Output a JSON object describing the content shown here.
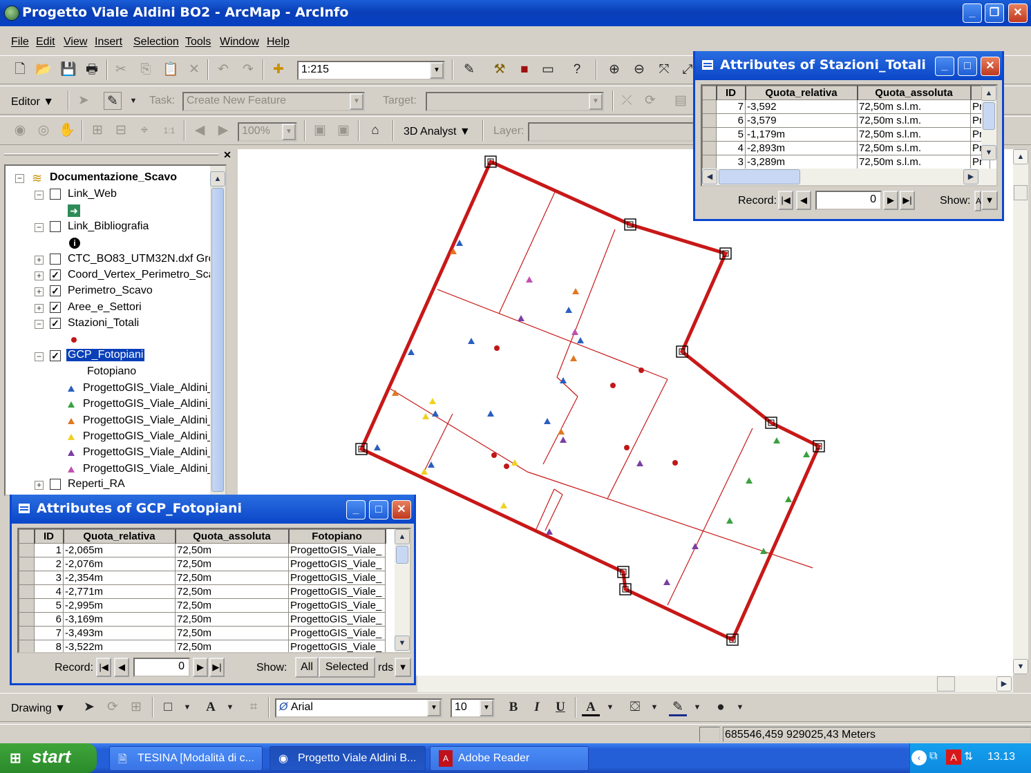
{
  "window": {
    "title": "Progetto Viale Aldini BO2 - ArcMap - ArcInfo",
    "minimize": "_",
    "maximize": "❐",
    "close": "✕"
  },
  "menu": [
    "File",
    "Edit",
    "View",
    "Insert",
    "Selection",
    "Tools",
    "Window",
    "Help"
  ],
  "standard_toolbar": {
    "scale": "1:215"
  },
  "editor_toolbar": {
    "editor_label": "Editor",
    "task_label": "Task:",
    "task_value": "Create New Feature",
    "target_label": "Target:"
  },
  "tools_toolbar": {
    "zoom_value": "100%",
    "analyst_label": "3D Analyst",
    "layer_label": "Layer:"
  },
  "toc": {
    "root": "Documentazione_Scavo",
    "items": [
      {
        "label": "Link_Web"
      },
      {
        "label": "Link_Bibliografia"
      },
      {
        "label": "CTC_BO83_UTM32N.dxf Grou"
      },
      {
        "label": "Coord_Vertex_Perimetro_Sca"
      },
      {
        "label": "Perimetro_Scavo"
      },
      {
        "label": "Aree_e_Settori"
      },
      {
        "label": "Stazioni_Totali"
      },
      {
        "label": "GCP_Fotopiani"
      },
      {
        "label": "Reperti_RA"
      }
    ],
    "field_heading": "Fotopiano",
    "legend_entries": [
      "ProgettoGIS_Viale_Aldini_",
      "ProgettoGIS_Viale_Aldini_",
      "ProgettoGIS_Viale_Aldini_",
      "ProgettoGIS_Viale_Aldini_",
      "ProgettoGIS_Viale_Aldini_",
      "ProgettoGIS_Viale_Aldini_"
    ],
    "legend_colors": [
      "#2a5fbf",
      "#3aa040",
      "#e07820",
      "#f0d020",
      "#7b3fa0",
      "#c050b0"
    ]
  },
  "stazioni_table": {
    "title": "Attributes of Stazioni_Totali",
    "columns": [
      "ID",
      "Quota_relativa",
      "Quota_assoluta",
      ""
    ],
    "rows": [
      [
        "7",
        "-3,592",
        "72,50m s.l.m.",
        "Pr"
      ],
      [
        "6",
        "-3,579",
        "72,50m s.l.m.",
        "Pr"
      ],
      [
        "5",
        "-1,179m",
        "72,50m s.l.m.",
        "Pr"
      ],
      [
        "4",
        "-2,893m",
        "72,50m s.l.m.",
        "Pr"
      ],
      [
        "3",
        "-3,289m",
        "72,50m s.l.m.",
        "Pr"
      ]
    ],
    "record_label": "Record:",
    "record_value": "0",
    "show_label": "Show:",
    "show_value": "A"
  },
  "gcp_table": {
    "title": "Attributes of GCP_Fotopiani",
    "columns": [
      "ID",
      "Quota_relativa",
      "Quota_assoluta",
      "Fotopiano"
    ],
    "rows": [
      [
        "1",
        "-2,065m",
        "72,50m",
        "ProgettoGIS_Viale_"
      ],
      [
        "2",
        "-2,076m",
        "72,50m",
        "ProgettoGIS_Viale_"
      ],
      [
        "3",
        "-2,354m",
        "72,50m",
        "ProgettoGIS_Viale_"
      ],
      [
        "4",
        "-2,771m",
        "72,50m",
        "ProgettoGIS_Viale_"
      ],
      [
        "5",
        "-2,995m",
        "72,50m",
        "ProgettoGIS_Viale_"
      ],
      [
        "6",
        "-3,169m",
        "72,50m",
        "ProgettoGIS_Viale_"
      ],
      [
        "7",
        "-3,493m",
        "72,50m",
        "ProgettoGIS_Viale_"
      ],
      [
        "8",
        "-3,522m",
        "72,50m",
        "ProgettoGIS_Viale_"
      ]
    ],
    "record_label": "Record:",
    "record_value": "0",
    "show_label": "Show:",
    "show_all": "All",
    "show_selected": "Selected",
    "records_label": "rds"
  },
  "drawing_toolbar": {
    "drawing_label": "Drawing",
    "font_name": "Arial",
    "font_size": "10",
    "bold": "B",
    "italic": "I",
    "underline": "U"
  },
  "status": {
    "coordinates": "685546,459  929025,43 Meters"
  },
  "taskbar": {
    "start": "start",
    "tasks": [
      "TESINA [Modalità di c...",
      "Progetto Viale Aldini B...",
      "Adobe Reader"
    ],
    "clock": "13.13"
  }
}
